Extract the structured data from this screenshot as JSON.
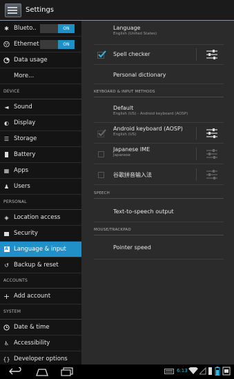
{
  "header": {
    "title": "Settings"
  },
  "sidebar": {
    "items": [
      {
        "label": "Blueto..",
        "icon": "bluetooth-icon",
        "toggle": "ON"
      },
      {
        "label": "Ethernet",
        "icon": "ethernet-icon",
        "toggle": "ON"
      },
      {
        "label": "Data usage",
        "icon": "data-usage-icon"
      },
      {
        "label": "More...",
        "icon": ""
      },
      {
        "section": "DEVICE"
      },
      {
        "label": "Sound",
        "icon": "sound-icon"
      },
      {
        "label": "Display",
        "icon": "display-icon"
      },
      {
        "label": "Storage",
        "icon": "storage-icon"
      },
      {
        "label": "Battery",
        "icon": "battery-icon"
      },
      {
        "label": "Apps",
        "icon": "apps-icon"
      },
      {
        "label": "Users",
        "icon": "users-icon"
      },
      {
        "section": "PERSONAL"
      },
      {
        "label": "Location access",
        "icon": "location-icon"
      },
      {
        "label": "Security",
        "icon": "lock-icon"
      },
      {
        "label": "Language & input",
        "icon": "language-icon",
        "selected": true
      },
      {
        "label": "Backup & reset",
        "icon": "backup-icon"
      },
      {
        "section": "ACCOUNTS"
      },
      {
        "label": "Add account",
        "icon": "plus-icon"
      },
      {
        "section": "SYSTEM"
      },
      {
        "label": "Date & time",
        "icon": "clock-icon"
      },
      {
        "label": "Accessibility",
        "icon": "accessibility-icon"
      },
      {
        "label": "Developer options",
        "icon": "developer-icon"
      }
    ]
  },
  "main": {
    "language": {
      "title": "Language",
      "sub": "English (United States)"
    },
    "spell_checker": {
      "title": "Spell checker",
      "checked": true
    },
    "personal_dictionary": {
      "title": "Personal dictionary"
    },
    "kb_header": "KEYBOARD & INPUT METHODS",
    "default": {
      "title": "Default",
      "sub": "English (US) - Android keyboard (AOSP)"
    },
    "aosp": {
      "title": "Android keyboard (AOSP)",
      "sub": "English (US)",
      "checked": true
    },
    "japanese": {
      "title": "Japanese IME",
      "sub": "Japanese",
      "checked": false
    },
    "pinyin": {
      "title": "谷歌拼音输入法",
      "checked": false
    },
    "speech_header": "SPEECH",
    "tts": {
      "title": "Text-to-speech output"
    },
    "mouse_header": "MOUSE/TRACKPAD",
    "pointer": {
      "title": "Pointer speed"
    }
  },
  "statusbar": {
    "time": "6:13"
  },
  "colors": {
    "accent": "#33b5e5",
    "selected": "#1f90c8",
    "background": "#2b2b2b"
  }
}
